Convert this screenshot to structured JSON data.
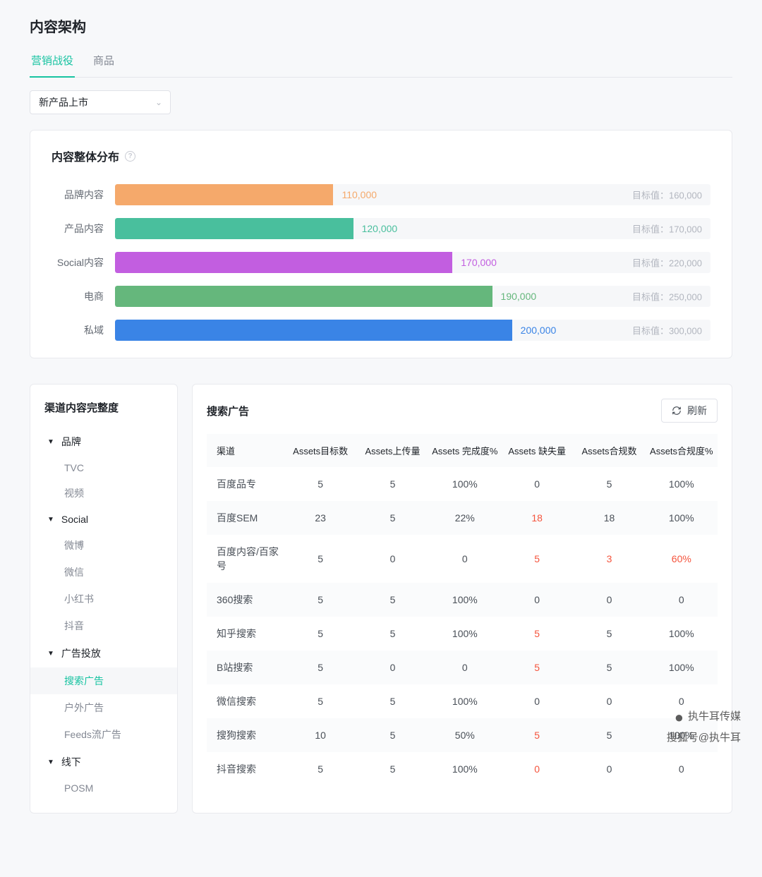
{
  "page_title": "内容架构",
  "tabs": [
    {
      "label": "营销战役",
      "active": true
    },
    {
      "label": "商品",
      "active": false
    }
  ],
  "filter_select": {
    "value": "新产品上市"
  },
  "distribution": {
    "title": "内容整体分布",
    "target_prefix": "目标值：",
    "max": 300000
  },
  "chart_data": {
    "type": "bar",
    "title": "内容整体分布",
    "xlabel": "",
    "ylabel": "",
    "xlim": [
      0,
      300000
    ],
    "series": [
      {
        "name": "品牌内容",
        "value": 110000,
        "target": 160000,
        "color": "#f5a96b",
        "value_color": "#f5a96b"
      },
      {
        "name": "产品内容",
        "value": 120000,
        "target": 170000,
        "color": "#49bf9d",
        "value_color": "#49bf9d"
      },
      {
        "name": "Social内容",
        "value": 170000,
        "target": 220000,
        "color": "#c25ee0",
        "value_color": "#c25ee0"
      },
      {
        "name": "电商",
        "value": 190000,
        "target": 250000,
        "color": "#65b77c",
        "value_color": "#65b77c"
      },
      {
        "name": "私域",
        "value": 200000,
        "target": 300000,
        "color": "#3a84e6",
        "value_color": "#3a84e6"
      }
    ]
  },
  "side_panel": {
    "title": "渠道内容完整度",
    "groups": [
      {
        "label": "品牌",
        "items": [
          {
            "label": "TVC"
          },
          {
            "label": "视频"
          }
        ]
      },
      {
        "label": "Social",
        "items": [
          {
            "label": "微博"
          },
          {
            "label": "微信"
          },
          {
            "label": "小红书"
          },
          {
            "label": "抖音"
          }
        ]
      },
      {
        "label": "广告投放",
        "items": [
          {
            "label": "搜索广告",
            "active": true
          },
          {
            "label": "户外广告"
          },
          {
            "label": "Feeds流广告"
          }
        ]
      },
      {
        "label": "线下",
        "items": [
          {
            "label": "POSM"
          }
        ]
      }
    ]
  },
  "table": {
    "title": "搜索广告",
    "refresh_label": "刷新",
    "columns": [
      "渠道",
      "Assets目标数",
      "Assets上传量",
      "Assets 完成度%",
      "Assets 缺失量",
      "Assets合规数",
      "Assets合规度%"
    ],
    "rows": [
      {
        "c0": "百度品专",
        "c1": "5",
        "c2": "5",
        "c3": "100%",
        "c4": "0",
        "c4_red": false,
        "c5": "5",
        "c5_red": false,
        "c6": "100%",
        "c6_red": false
      },
      {
        "c0": "百度SEM",
        "c1": "23",
        "c2": "5",
        "c3": "22%",
        "c4": "18",
        "c4_red": true,
        "c5": "18",
        "c5_red": false,
        "c6": "100%",
        "c6_red": false
      },
      {
        "c0": "百度内容/百家号",
        "c1": "5",
        "c2": "0",
        "c3": "0",
        "c4": "5",
        "c4_red": true,
        "c5": "3",
        "c5_red": true,
        "c6": "60%",
        "c6_red": true
      },
      {
        "c0": "360搜索",
        "c1": "5",
        "c2": "5",
        "c3": "100%",
        "c4": "0",
        "c4_red": false,
        "c5": "0",
        "c5_red": false,
        "c6": "0",
        "c6_red": false
      },
      {
        "c0": "知乎搜索",
        "c1": "5",
        "c2": "5",
        "c3": "100%",
        "c4": "5",
        "c4_red": true,
        "c5": "5",
        "c5_red": false,
        "c6": "100%",
        "c6_red": false
      },
      {
        "c0": "B站搜索",
        "c1": "5",
        "c2": "0",
        "c3": "0",
        "c4": "5",
        "c4_red": true,
        "c5": "5",
        "c5_red": false,
        "c6": "100%",
        "c6_red": false
      },
      {
        "c0": "微信搜索",
        "c1": "5",
        "c2": "5",
        "c3": "100%",
        "c4": "0",
        "c4_red": false,
        "c5": "0",
        "c5_red": false,
        "c6": "0",
        "c6_red": false
      },
      {
        "c0": "搜狗搜索",
        "c1": "10",
        "c2": "5",
        "c3": "50%",
        "c4": "5",
        "c4_red": true,
        "c5": "5",
        "c5_red": false,
        "c6": "100%",
        "c6_red": false
      },
      {
        "c0": "抖音搜索",
        "c1": "5",
        "c2": "5",
        "c3": "100%",
        "c4": "0",
        "c4_red": true,
        "c5": "0",
        "c5_red": false,
        "c6": "0",
        "c6_red": false
      }
    ]
  },
  "watermark": {
    "line1": "执牛耳传媒",
    "line2": "搜狐号@执牛耳"
  }
}
